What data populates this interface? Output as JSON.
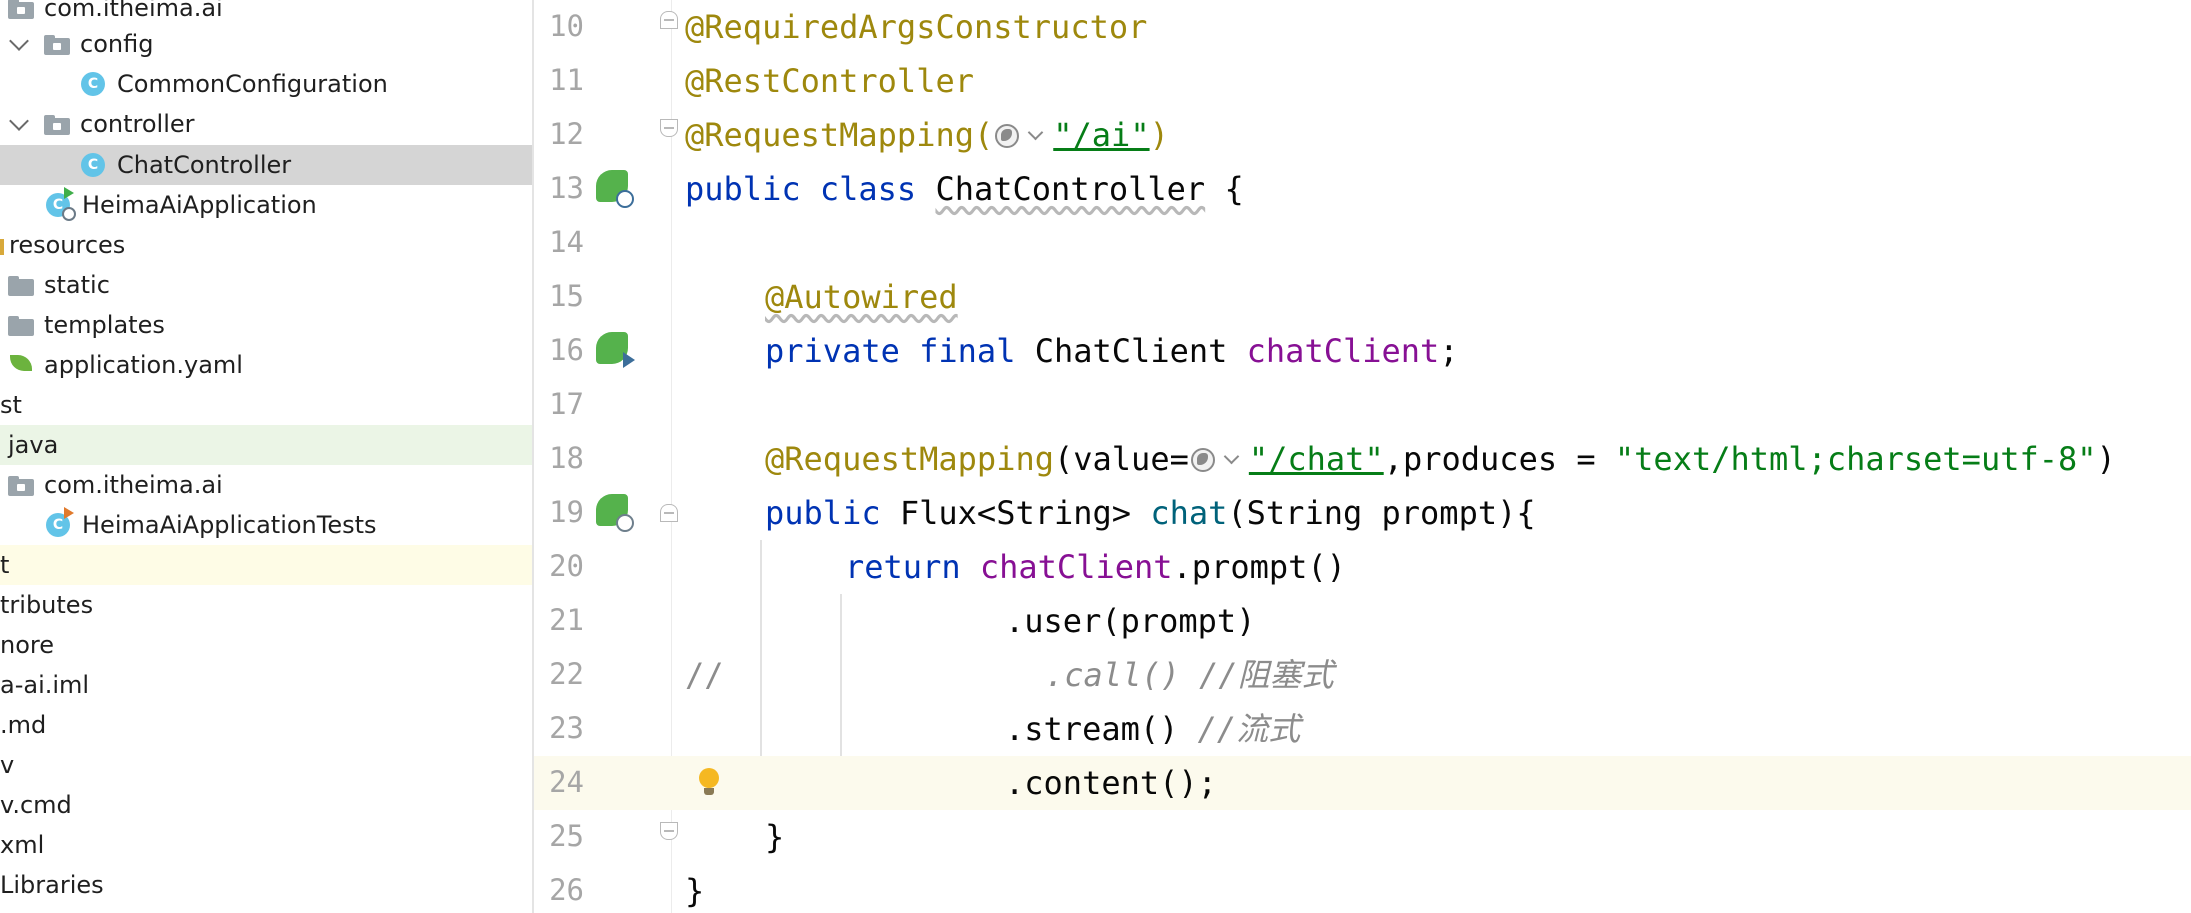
{
  "project_tree": {
    "items": [
      {
        "label": "com.itheima.ai",
        "kind": "package"
      },
      {
        "label": "config",
        "kind": "folder"
      },
      {
        "label": "CommonConfiguration",
        "kind": "class"
      },
      {
        "label": "controller",
        "kind": "folder"
      },
      {
        "label": "ChatController",
        "kind": "class",
        "selected": true
      },
      {
        "label": "HeimaAiApplication",
        "kind": "app-class"
      },
      {
        "label": "resources",
        "kind": "resources"
      },
      {
        "label": "static",
        "kind": "folder"
      },
      {
        "label": "templates",
        "kind": "folder"
      },
      {
        "label": "application.yaml",
        "kind": "spring-config"
      },
      {
        "label": "st",
        "kind": "folder"
      },
      {
        "label": "java",
        "kind": "test-source"
      },
      {
        "label": "com.itheima.ai",
        "kind": "package"
      },
      {
        "label": "HeimaAiApplicationTests",
        "kind": "test-class"
      },
      {
        "label": "t",
        "kind": "excluded"
      },
      {
        "label": "tributes",
        "kind": "file"
      },
      {
        "label": "nore",
        "kind": "file"
      },
      {
        "label": "a-ai.iml",
        "kind": "file"
      },
      {
        "label": ".md",
        "kind": "file"
      },
      {
        "label": "v",
        "kind": "file"
      },
      {
        "label": "v.cmd",
        "kind": "file"
      },
      {
        "label": "xml",
        "kind": "file"
      },
      {
        "label": "Libraries",
        "kind": "libraries"
      }
    ]
  },
  "editor": {
    "line_numbers": [
      "10",
      "11",
      "12",
      "13",
      "14",
      "15",
      "16",
      "17",
      "18",
      "19",
      "20",
      "21",
      "22",
      "23",
      "24",
      "25",
      "26"
    ],
    "code": {
      "l10_annotation": "@RequiredArgsConstructor",
      "l11_annotation": "@RestController",
      "l12_annotation": "@RequestMapping(",
      "l12_string": "\"/ai\"",
      "l12_close": ")",
      "l13_public": "public",
      "l13_class": "class",
      "l13_name": "ChatController",
      "l13_brace": " {",
      "l15_annotation": "@Autowired",
      "l16_private": "private",
      "l16_final": "final",
      "l16_type": "ChatClient",
      "l16_field": "chatClient",
      "l16_semi": ";",
      "l18_annotation": "@RequestMapping",
      "l18_value": "(value=",
      "l18_path": "\"/chat\"",
      "l18_produces": ",produces = ",
      "l18_mime": "\"text/html;charset=utf-8\"",
      "l18_close": ")",
      "l19_public": "public",
      "l19_return_type": "Flux<String>",
      "l19_method": "chat",
      "l19_params": "(String prompt){",
      "l20_return": "return",
      "l20_field": "chatClient",
      "l20_call": ".prompt()",
      "l21_user": ".user(prompt)",
      "l22_slashes": "//",
      "l22_comment": ".call() //阻塞式",
      "l23_stream": ".stream()",
      "l23_comment": "//流式",
      "l24_content": ".content();",
      "l25_brace": "}",
      "l26_brace": "}"
    }
  },
  "colors": {
    "annotation": "#9e880d",
    "keyword": "#0033b3",
    "string": "#067d17",
    "field": "#871094",
    "method": "#00627a",
    "comment": "#8c8c8c",
    "selection": "#d5d5d5",
    "current_line": "#fcfaed"
  }
}
